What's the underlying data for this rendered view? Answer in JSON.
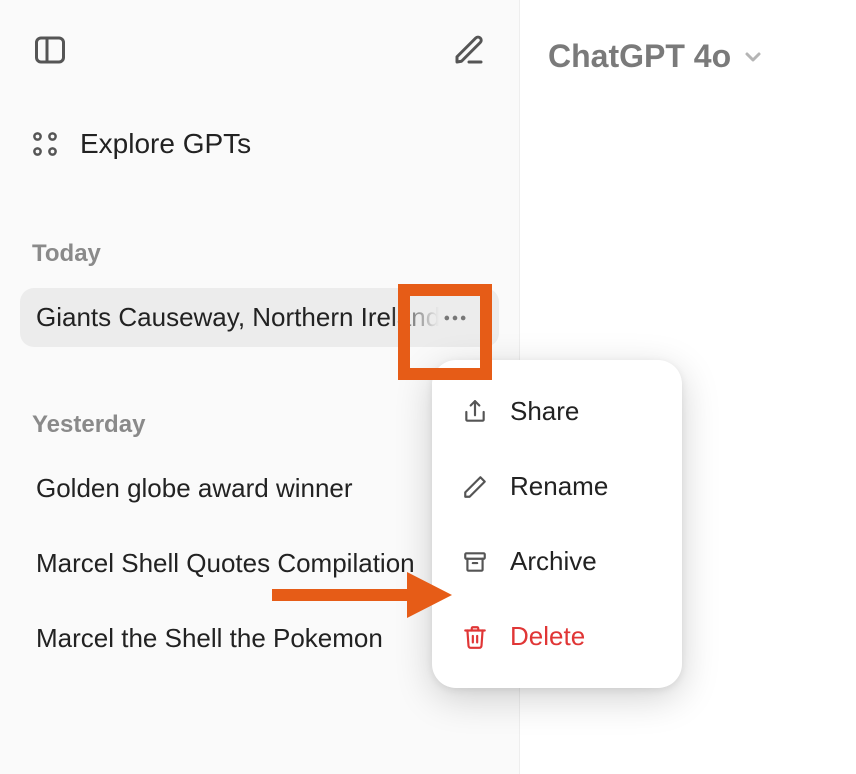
{
  "model_switcher": {
    "label": "ChatGPT 4o"
  },
  "sidebar": {
    "explore_label": "Explore GPTs",
    "sections": [
      {
        "label": "Today",
        "items": [
          {
            "title": "Giants Causeway, Northern Ireland",
            "active": true
          }
        ]
      },
      {
        "label": "Yesterday",
        "items": [
          {
            "title": "Golden globe award winner"
          },
          {
            "title": "Marcel Shell Quotes Compilation"
          },
          {
            "title": "Marcel the Shell the Pokemon"
          }
        ]
      }
    ]
  },
  "context_menu": {
    "share": "Share",
    "rename": "Rename",
    "archive": "Archive",
    "delete": "Delete"
  }
}
